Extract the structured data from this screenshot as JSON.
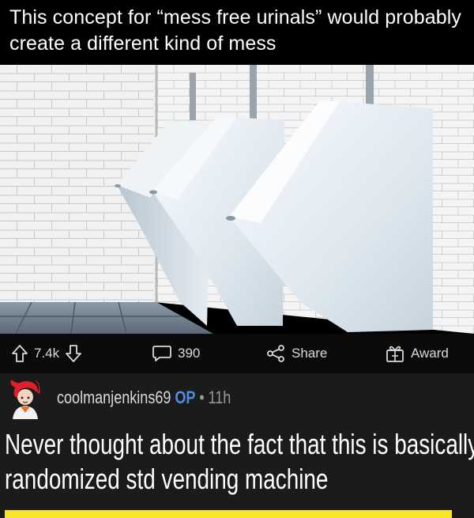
{
  "post": {
    "title": "This concept for “mess free urinals” would probably create a different kind of mess"
  },
  "actions": {
    "upvote_count": "7.4k",
    "comment_count": "390",
    "share_label": "Share",
    "award_label": "Award"
  },
  "comment": {
    "author": "coolmanjenkins69",
    "op_badge": "OP",
    "separator": "•",
    "age": "11h",
    "body_line1": "Never thought about the fact that this is basically a",
    "body_line2": "randomized std vending machine"
  },
  "colors": {
    "background": "#000000",
    "action_bar": "#0b0b0b",
    "comment_bg": "#1b1b1b",
    "op_badge": "#4b8fe0",
    "highlight": "#f7e52a"
  }
}
